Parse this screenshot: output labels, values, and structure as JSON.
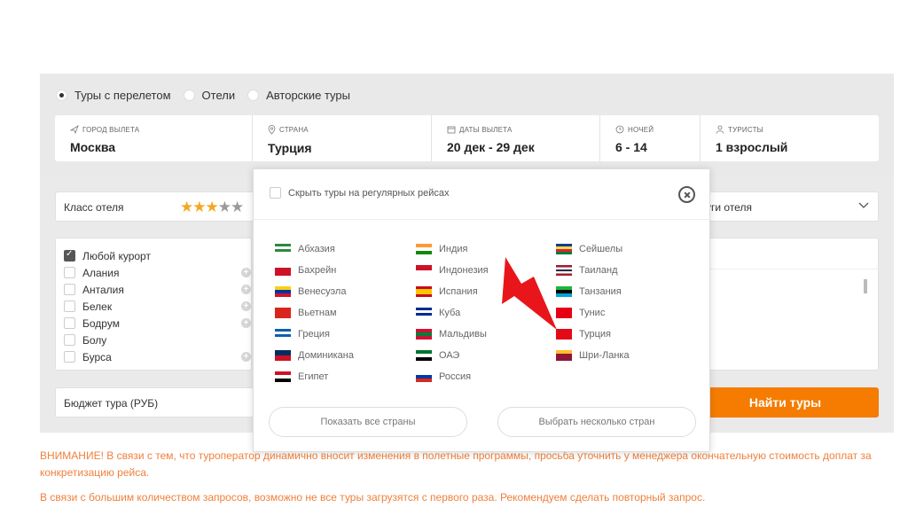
{
  "tabs": [
    {
      "label": "Туры с перелетом",
      "selected": true
    },
    {
      "label": "Отели",
      "selected": false
    },
    {
      "label": "Авторские туры",
      "selected": false
    }
  ],
  "search": {
    "departure": {
      "label": "ГОРОД ВЫЛЕТА",
      "value": "Москва"
    },
    "country": {
      "label": "СТРАНА",
      "value": "Турция"
    },
    "dates": {
      "label": "ДАТЫ ВЫЛЕТА",
      "value": "20 дек - 29 дек"
    },
    "nights": {
      "label": "НОЧЕЙ",
      "value": "6 - 14"
    },
    "tourists": {
      "label": "ТУРИСТЫ",
      "value": "1 взрослый"
    }
  },
  "filters": {
    "hotel_class_label": "Класс отеля",
    "stars_filled": 3,
    "stars_total": 5,
    "services_label": "уги отеля",
    "budget_label": "Бюджет тура (РУБ)",
    "find_button": "Найти туры"
  },
  "resorts": [
    {
      "label": "Любой курорт",
      "checked": true,
      "plus": false
    },
    {
      "label": "Алания",
      "checked": false,
      "plus": true
    },
    {
      "label": "Анталия",
      "checked": false,
      "plus": true
    },
    {
      "label": "Белек",
      "checked": false,
      "plus": true
    },
    {
      "label": "Бодрум",
      "checked": false,
      "plus": true
    },
    {
      "label": "Болу",
      "checked": false,
      "plus": false
    },
    {
      "label": "Бурса",
      "checked": false,
      "plus": true
    }
  ],
  "modal": {
    "hide_regular_label": "Скрыть туры на регулярных рейсах",
    "columns": [
      [
        "Абхазия",
        "Бахрейн",
        "Венесуэла",
        "Вьетнам",
        "Греция",
        "Доминикана",
        "Египет"
      ],
      [
        "Индия",
        "Индонезия",
        "Испания",
        "Куба",
        "Мальдивы",
        "ОАЭ",
        "Россия"
      ],
      [
        "Сейшелы",
        "Таиланд",
        "Танзания",
        "Тунис",
        "Турция",
        "Шри-Ланка"
      ]
    ],
    "show_all_button": "Показать все страны",
    "select_multiple_button": "Выбрать несколько стран"
  },
  "notices": [
    "ВНИМАНИЕ! В связи с тем, что туроператор динамично вносит изменения в полетные программы, просьба уточнить у менеджера окончательную стоимость доплат за конкретизацию рейса.",
    "В связи с большим количеством запросов, возможно не все туры загрузятся с первого раза. Рекомендуем сделать повторный запрос."
  ],
  "colors": {
    "accent": "#f57c00",
    "notice": "#f0803c",
    "star": "#f5a623",
    "arrow": "#e8161b"
  }
}
